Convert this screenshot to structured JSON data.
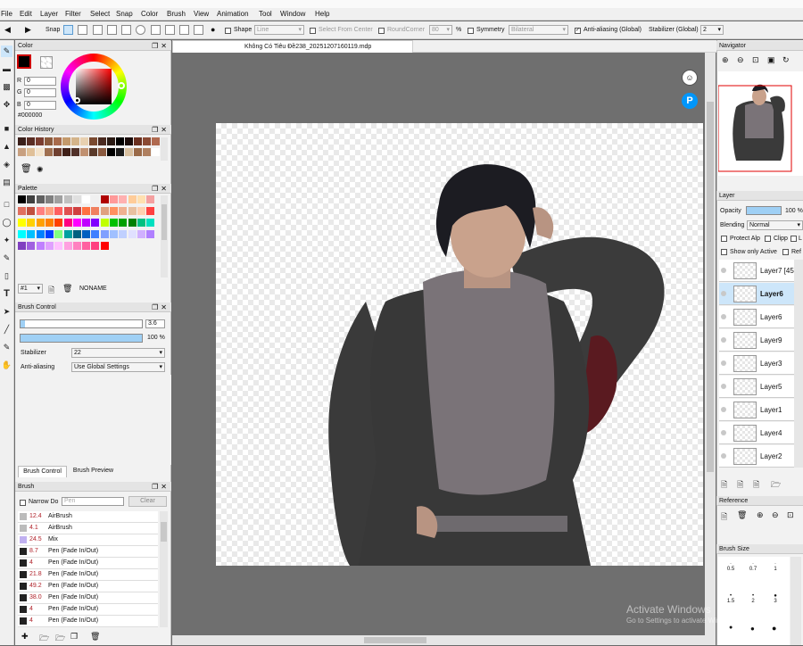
{
  "menu": [
    "File",
    "Edit",
    "Layer",
    "Filter",
    "Select",
    "Snap",
    "Color",
    "Brush",
    "View",
    "Animation",
    "Tool",
    "Window",
    "Help"
  ],
  "toolbar": {
    "snap": "Snap",
    "shape_label": "Shape",
    "shape_value": "Line",
    "select_from_center": "Select From Center",
    "round_corner": "RoundCorner",
    "round_corner_value": "80",
    "percent": "%",
    "symmetry": "Symmetry",
    "symmetry_value": "Bilateral",
    "anti_aliasing": "Anti-aliasing (Global)",
    "stabilizer_label": "Stabilizer (Global)",
    "stabilizer_value": "2"
  },
  "document_tab": "Không Có Tiêu Đề238_20251207160119.mdp",
  "color_panel": {
    "title": "Color",
    "r_label": "R",
    "r": "0",
    "g_label": "G",
    "g": "0",
    "b_label": "B",
    "b": "0",
    "hex": "#000000"
  },
  "color_history": {
    "title": "Color History",
    "swatches": [
      "#3a1f1a",
      "#5a2d24",
      "#7a3d30",
      "#8b5a3c",
      "#a86b4c",
      "#c49a6c",
      "#d4b48a",
      "#e8d0b0",
      "#7a4a30",
      "#4a2a20",
      "#2a1a14",
      "#000000",
      "#1a0c0a",
      "#6a3020",
      "#8a4a34",
      "#b06a50",
      "#c8a080",
      "#e0c098",
      "#f4e4cc",
      "#a07050",
      "#704030",
      "#402018",
      "#503028",
      "#c09070",
      "#5a3a2a",
      "#8a5a40",
      "#000000",
      "#1a1a1a",
      "#d8c0a0",
      "#9a6a48",
      "#b08060",
      "#ffffff"
    ]
  },
  "palette": {
    "title": "Palette",
    "swatches": [
      "#000000",
      "#404040",
      "#606060",
      "#808080",
      "#a0a0a0",
      "#c0c0c0",
      "#e0e0e0",
      "#ffffff",
      "#f0f0f0",
      "#b00000",
      "#ff9999",
      "#ffb0b0",
      "#ffcc99",
      "#ffe0b0",
      "#f4a0a0",
      "#e07060",
      "#c05040",
      "#ff8080",
      "#ffa080",
      "#ff6060",
      "#e05050",
      "#d04040",
      "#ff7040",
      "#f08060",
      "#e0a080",
      "#ff9060",
      "#f0b090",
      "#e8c0a0",
      "#ffd0b0",
      "#ff4040",
      "#ffff00",
      "#ffd000",
      "#ffa000",
      "#ff8000",
      "#ff4000",
      "#ff0080",
      "#ff00ff",
      "#c000ff",
      "#8000ff",
      "#c0ff00",
      "#00c000",
      "#00a000",
      "#008000",
      "#00c080",
      "#00e0c0",
      "#00ffff",
      "#00c0ff",
      "#0080ff",
      "#0040ff",
      "#80ff80",
      "#00a0a0",
      "#006080",
      "#0060c0",
      "#4080ff",
      "#80a0ff",
      "#a0c0ff",
      "#c0d0ff",
      "#e0e0ff",
      "#d0b0ff",
      "#b080ff",
      "#8040c0",
      "#a060e0",
      "#c080ff",
      "#e0a0ff",
      "#ffc0ff",
      "#ffa0e0",
      "#ff80c0",
      "#ff60a0",
      "#ff4080",
      "#ff0000"
    ],
    "page": "#1",
    "name": "NONAME"
  },
  "brush_control": {
    "title": "Brush Control",
    "size_value": "3.6",
    "size_fraction": 0.04,
    "opacity_value": "100 %",
    "stabilizer_label": "Stabilizer",
    "stabilizer_value": "22",
    "anti_label": "Anti-aliasing",
    "anti_value": "Use Global Settings",
    "tab_control": "Brush Control",
    "tab_preview": "Brush Preview"
  },
  "brush_panel": {
    "title": "Brush",
    "narrow_down": "Narrow Do",
    "search_placeholder": "Pen",
    "clear": "Clear",
    "items": [
      {
        "size": "12.4",
        "name": "AirBrush",
        "icon": "#bbbbbb"
      },
      {
        "size": "4.1",
        "name": "AirBrush",
        "icon": "#bbbbbb"
      },
      {
        "size": "24.5",
        "name": "Mix",
        "icon": "#c0b0f0"
      },
      {
        "size": "8.7",
        "name": "Pen (Fade In/Out)",
        "icon": "#222222"
      },
      {
        "size": "4",
        "name": "Pen (Fade In/Out)",
        "icon": "#222222"
      },
      {
        "size": "21.8",
        "name": "Pen (Fade In/Out)",
        "icon": "#222222"
      },
      {
        "size": "49.2",
        "name": "Pen (Fade In/Out)",
        "icon": "#222222"
      },
      {
        "size": "38.0",
        "name": "Pen (Fade In/Out)",
        "icon": "#222222"
      },
      {
        "size": "4",
        "name": "Pen (Fade In/Out)",
        "icon": "#222222"
      },
      {
        "size": "4",
        "name": "Pen (Fade In/Out)",
        "icon": "#222222"
      }
    ]
  },
  "navigator": {
    "title": "Navigator"
  },
  "layer_panel": {
    "title": "Layer",
    "opacity_label": "Opacity",
    "opacity_value": "100 %",
    "blending_label": "Blending",
    "blending_value": "Normal",
    "protect_alpha": "Protect Alp",
    "clipping": "Clipp",
    "lock": "L",
    "show_only_active": "Show only Active",
    "reference": "Ref",
    "layers": [
      "Layer7 [45",
      "Layer6",
      "Layer6",
      "Layer9",
      "Layer3",
      "Layer5",
      "Layer1",
      "Layer4",
      "Layer2"
    ],
    "active_index": 1
  },
  "reference_panel": {
    "title": "Reference"
  },
  "brush_size_panel": {
    "title": "Brush Size",
    "sizes": [
      "0.5",
      "0.7",
      "1",
      "1.5",
      "2",
      "3"
    ]
  },
  "watermark": {
    "line1": "Activate Windows",
    "line2": "Go to Settings to activate Windows."
  },
  "colors": {
    "accent": "#9fd0f5",
    "selected_layer": "#cde6fa"
  }
}
